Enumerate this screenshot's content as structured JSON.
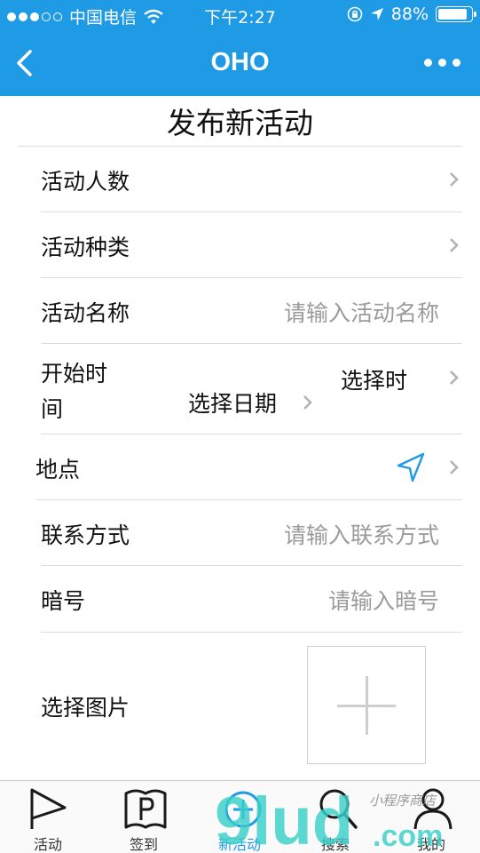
{
  "status_bar": {
    "carrier": "中国电信",
    "time": "下午2:27",
    "battery": "88%",
    "battery_level": 0.88
  },
  "navbar": {
    "title": "OHO",
    "back_icon": "chevron-left-icon",
    "more_icon": "more-dots-icon"
  },
  "page": {
    "heading": "发布新活动"
  },
  "form": {
    "participants": {
      "label": "活动人数"
    },
    "category": {
      "label": "活动种类"
    },
    "name": {
      "label": "活动名称",
      "placeholder": "请输入活动名称"
    },
    "start_time": {
      "label_line1": "开始时",
      "label_line2": "间",
      "date_picker": "选择日期",
      "time_picker": "选择时"
    },
    "location": {
      "label": "地点",
      "icon": "location-arrow-icon"
    },
    "contact": {
      "label": "联系方式",
      "placeholder": "请输入联系方式"
    },
    "password": {
      "label": "暗号",
      "placeholder": "请输入暗号"
    },
    "image": {
      "label": "选择图片"
    }
  },
  "tabbar": {
    "tabs": [
      {
        "label": "活动",
        "icon": "flag-icon"
      },
      {
        "label": "签到",
        "icon": "checkin-book-icon"
      },
      {
        "label": "新活动",
        "icon": "plus-circle-icon",
        "active": true
      },
      {
        "label": "搜索",
        "icon": "search-icon"
      },
      {
        "label": "我的",
        "icon": "user-icon"
      }
    ]
  },
  "watermark": {
    "text_main": "9lud",
    "text_domain": ".com",
    "text_script": "小程序商店"
  },
  "colors": {
    "primary": "#1f9be6",
    "placeholder": "#9b9b9b",
    "divider": "#dcdcdc",
    "watermark": "#39d0c8"
  }
}
